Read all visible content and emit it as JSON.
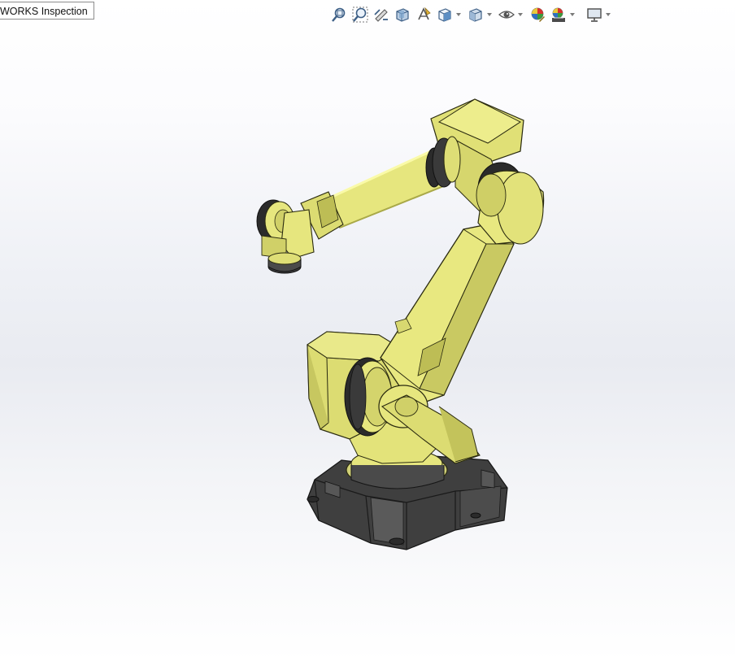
{
  "window": {
    "tab_title": "WORKS Inspection"
  },
  "toolbar": {
    "buttons": [
      {
        "name": "zoom-to-fit-icon"
      },
      {
        "name": "zoom-to-area-icon"
      },
      {
        "name": "previous-view-icon"
      },
      {
        "name": "section-view-icon"
      },
      {
        "name": "dynamic-annotation-views-icon"
      },
      {
        "name": "view-orientation-icon"
      },
      {
        "name": "display-style-icon"
      },
      {
        "name": "hide-show-items-icon"
      },
      {
        "name": "edit-appearance-icon"
      },
      {
        "name": "apply-scene-icon"
      },
      {
        "name": "view-settings-icon"
      }
    ]
  },
  "model": {
    "name": "industrial-robot-arm",
    "colors": {
      "body": "#e6e67e",
      "shade": "#bdbd55",
      "dark": "#6b6b2a",
      "base": "#3f3f3f",
      "base_light": "#5a5a5a",
      "ring": "#2b2b2b"
    }
  }
}
